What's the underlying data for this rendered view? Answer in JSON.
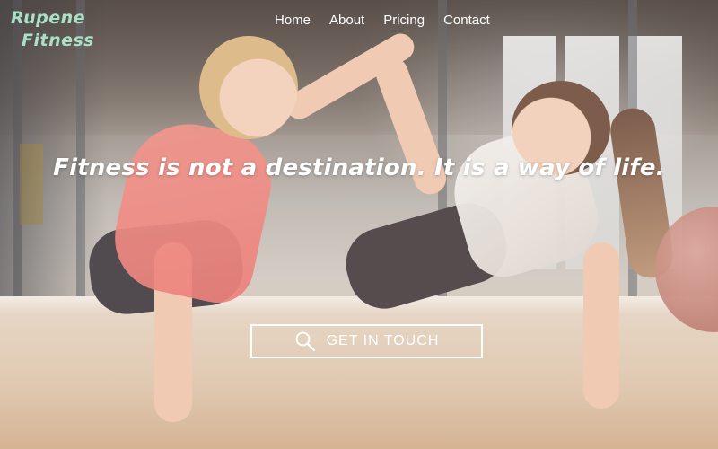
{
  "brand": {
    "line1": "Rupene",
    "line2": "Fitness"
  },
  "nav": {
    "items": [
      {
        "label": "Home"
      },
      {
        "label": "About"
      },
      {
        "label": "Pricing"
      },
      {
        "label": "Contact"
      }
    ]
  },
  "hero": {
    "tagline": "Fitness is not a destination. It is a way of life.",
    "cta_label": "GET IN TOUCH",
    "cta_icon": "search-icon"
  },
  "colors": {
    "logo": "#a9e0c6",
    "text": "#ffffff"
  }
}
